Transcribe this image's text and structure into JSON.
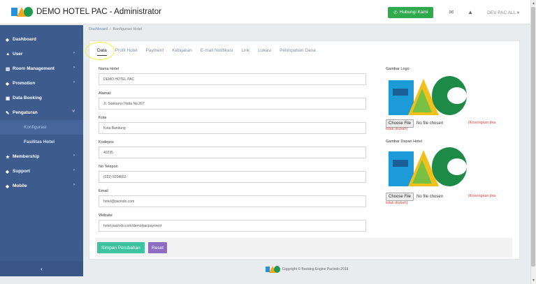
{
  "app": {
    "title": "DEMO HOTEL PAC - Administrator"
  },
  "topbar": {
    "contact_label": "Hubungi Kami",
    "mail_icon": "✉",
    "bell_icon": "▲",
    "user_label": "DEV PAC ALL ▾"
  },
  "sidebar": {
    "items": [
      {
        "icon": "◈",
        "label": "Dashboard"
      },
      {
        "icon": "▲",
        "label": "User"
      },
      {
        "icon": "▤",
        "label": "Room Management"
      },
      {
        "icon": "◆",
        "label": "Promotion"
      },
      {
        "icon": "▣",
        "label": "Data Booking"
      },
      {
        "icon": "✎",
        "label": "Pengaturan"
      },
      {
        "icon": "★",
        "label": "Membership"
      },
      {
        "icon": "◆",
        "label": "Support"
      },
      {
        "icon": "◆",
        "label": "Mobile"
      }
    ],
    "sub_items": [
      {
        "label": "Konfigurasi"
      },
      {
        "label": "Fasilitas Hotel"
      }
    ],
    "collapse_label": "‹"
  },
  "breadcrumb": {
    "home": "Dashboard",
    "current": "Konfigurasi Hotel"
  },
  "tabs": [
    "Data",
    "Profil Hotel",
    "Payment",
    "Kebijakan",
    "E-mail Notifikasi",
    "Link",
    "Lokasi",
    "Pelimpahan Dana"
  ],
  "form": {
    "fields": [
      {
        "label": "Nama Hotel",
        "value": "DEMO HOTEL PAC"
      },
      {
        "label": "Alamat",
        "value": "Jl. Soekarno Hatta No.267"
      },
      {
        "label": "Kota",
        "value": "Kota Bandung"
      },
      {
        "label": "Kodepos",
        "value": "40235"
      },
      {
        "label": "No Telepon",
        "value": "(022) 5204653"
      },
      {
        "label": "Email",
        "value": "hotel@pacindo.com"
      },
      {
        "label": "Website",
        "value": "hotel.pacindo.com/demo/pacpayment"
      }
    ],
    "logo_label": "Gambar Logo",
    "front_label": "Gambar Depan Hotel",
    "choose_file": "Choose File",
    "no_file": "No file chosen",
    "hint_a": "(Kosongkan jika",
    "hint_b": "tidak diubah)"
  },
  "actions": {
    "save": "Simpan Perubahan",
    "reset": "Reset"
  },
  "footer": {
    "text": "Copyright © Booking Engine Pacindo 2018"
  },
  "colors": {
    "sidebar": "#3d5b8c",
    "accent_green": "#2eaa4c",
    "save": "#3ec3a0",
    "reset": "#8e6cc1"
  }
}
